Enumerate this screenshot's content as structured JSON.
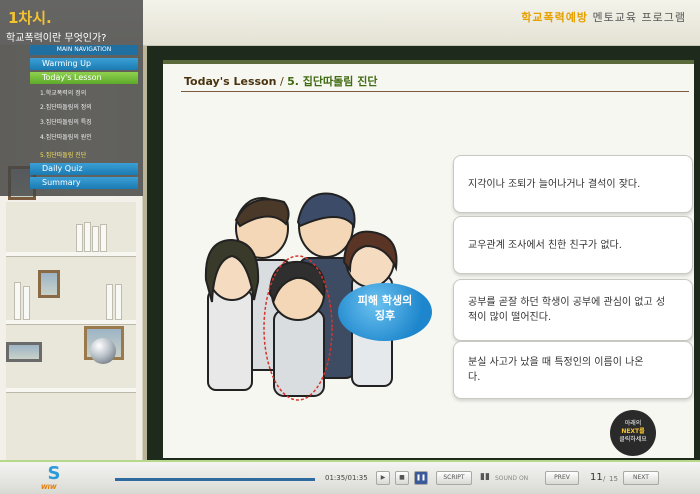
{
  "header": {
    "brand_accent": "학교폭력예방",
    "brand_rest": "멘토교육 프로그램"
  },
  "nav": {
    "chapter": "1차시.",
    "chapter_title": "학교폭력이란 무엇인가?",
    "heading": "MAIN NAVIGATION",
    "items": [
      {
        "label": "Warming Up"
      },
      {
        "label": "Today's Lesson"
      },
      {
        "label": "Daily Quiz"
      },
      {
        "label": "Summary"
      }
    ],
    "subitems": [
      {
        "label": "1.학교폭력의 정의"
      },
      {
        "label": "2.집단따돌림의 정의"
      },
      {
        "label": "3.집단따돌림의 특징"
      },
      {
        "label": "4.집단따돌림의 원인"
      },
      {
        "label": "5.집단따돌림 진단"
      }
    ]
  },
  "lesson": {
    "title_lead": "Today's Lesson",
    "title_sep": "/ ",
    "title_sub": "5. 집단따돌림 진단"
  },
  "statements": [
    "지각이나 조퇴가 늘어나거나 결석이 잦다.",
    "교우관계 조사에서 친한 친구가 없다.",
    "공부를 곧잘 하던 학생이 공부에 관심이 없고 성적이 많이 떨어진다.",
    "분실 사고가 났을 때 특정인의 이름이 나온다."
  ],
  "bubble": {
    "line1": "피해 학생의",
    "line2": "징후"
  },
  "next_hint": {
    "line1": "아래의",
    "line2": "NEXT를",
    "line3": "클릭하세요"
  },
  "controls": {
    "logo": "WIW",
    "time": "01:35/01:35",
    "script": "SCRIPT",
    "sound": "SOUND ON",
    "prev": "PREV",
    "next": "NEXT",
    "page_current": "11",
    "page_sep": "/",
    "page_total": "15",
    "progress": 1.0
  },
  "colors": {
    "accent_gold": "#f4c430",
    "nav_blue": "#1b7ab2",
    "nav_green": "#5ea92a",
    "board": "#1e2b1c",
    "bubble_blue": "#1d86cc"
  }
}
